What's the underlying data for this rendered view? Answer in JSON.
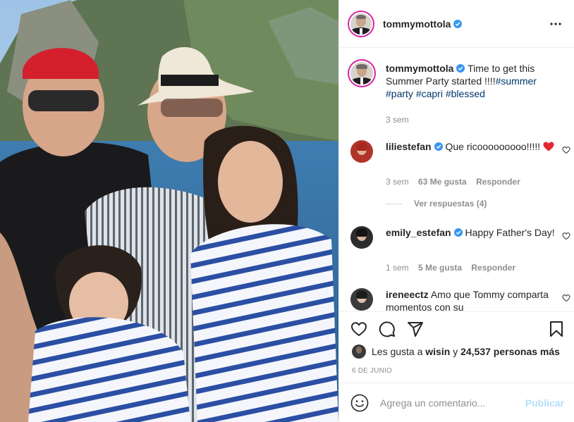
{
  "post": {
    "author": "tommymottola",
    "more_icon": "more-horizontal-icon",
    "verified_color": "#3897f0"
  },
  "caption": {
    "username": "tommymottola",
    "text": "Time to get this Summer Party started !!!!",
    "hashtags": [
      "#summer",
      "#party",
      "#capri",
      "#blessed"
    ],
    "time": "3 sem"
  },
  "comments": [
    {
      "username": "liliestefan",
      "verified": true,
      "text": "Que ricooooooooo!!!!!",
      "emoji": "red-heart",
      "time": "3 sem",
      "likes": "63 Me gusta",
      "reply": "Responder"
    },
    {
      "username": "emily_estefan",
      "verified": true,
      "text": "Happy Father's Day!",
      "time": "1 sem",
      "likes": "5 Me gusta",
      "reply": "Responder"
    },
    {
      "username": "ireneectz",
      "verified": false,
      "text": "Amo que Tommy comparta momentos con su"
    }
  ],
  "view_replies": "Ver respuestas (4)",
  "actions": {
    "icons": [
      "heart-icon",
      "comment-icon",
      "share-icon",
      "bookmark-icon"
    ]
  },
  "likes": {
    "prefix": "Les gusta a",
    "user": "wisin",
    "middle": "y",
    "count": "24,537 personas más"
  },
  "date": "6 DE JUNIO",
  "composer": {
    "placeholder": "Agrega un comentario...",
    "publish": "Publicar"
  },
  "colors": {
    "link": "#00376b",
    "muted": "#8e8e8e",
    "heart": "#ed4956",
    "publish_disabled": "#b2dffc"
  }
}
